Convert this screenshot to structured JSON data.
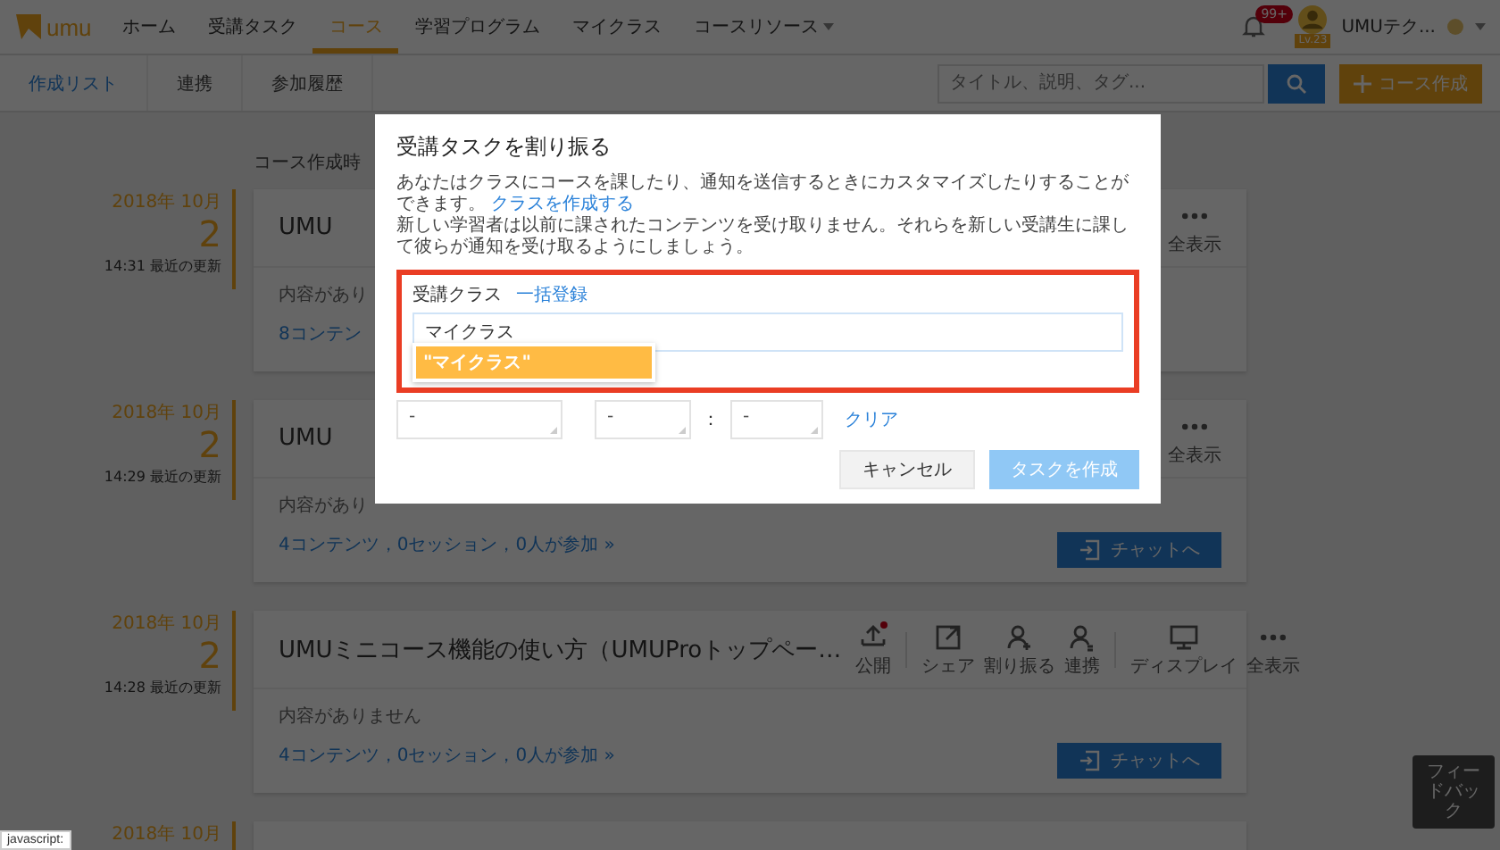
{
  "header": {
    "logo": "umu",
    "nav": [
      {
        "label": "ホーム",
        "selected": false,
        "dropdown": false
      },
      {
        "label": "受講タスク",
        "selected": false,
        "dropdown": false
      },
      {
        "label": "コース",
        "selected": true,
        "dropdown": false
      },
      {
        "label": "学習プログラム",
        "selected": false,
        "dropdown": false
      },
      {
        "label": "マイクラス",
        "selected": false,
        "dropdown": false
      },
      {
        "label": "コースリソース",
        "selected": false,
        "dropdown": true
      }
    ],
    "notification_badge": "99+",
    "user": {
      "level": "Lv.23",
      "name": "UMUテク..."
    }
  },
  "subnav": {
    "tabs": [
      {
        "label": "作成リスト",
        "selected": true
      },
      {
        "label": "連携",
        "selected": false
      },
      {
        "label": "参加履歴",
        "selected": false
      }
    ],
    "search": {
      "placeholder": "タイトル、説明、タグ..."
    },
    "create_button": "コース作成"
  },
  "list": {
    "heading": "コース作成時",
    "courses": [
      {
        "month": "2018年 10月",
        "day": "2",
        "updated": "14:31 最近の更新",
        "title": "UMU",
        "summary": "内容があり",
        "stats": "8コンテン",
        "actions": [
          {
            "label": "全表示",
            "kind": "more",
            "alert": false
          }
        ]
      },
      {
        "month": "2018年 10月",
        "day": "2",
        "updated": "14:29 最近の更新",
        "title": "UMU",
        "summary": "内容があり",
        "stats": "4コンテンツ，0セッション，0人が参加 »",
        "chat_button": "チャットへ",
        "actions": [
          {
            "label": "全表示",
            "kind": "more",
            "alert": false
          }
        ]
      },
      {
        "month": "2018年 10月",
        "day": "2",
        "updated": "14:28 最近の更新",
        "title": "UMUミニコース機能の使い方（UMUProトップペー…",
        "summary": "内容がありません",
        "stats": "4コンテンツ，0セッション，0人が参加 »",
        "chat_button": "チャットへ",
        "actions": [
          {
            "label": "公開",
            "kind": "publish",
            "alert": true
          },
          {
            "label": "シェア",
            "kind": "share",
            "alert": false
          },
          {
            "label": "割り振る",
            "kind": "assign",
            "alert": false
          },
          {
            "label": "連携",
            "kind": "link",
            "alert": false
          },
          {
            "label": "ディスプレイ",
            "kind": "display",
            "alert": false
          },
          {
            "label": "全表示",
            "kind": "more",
            "alert": false
          }
        ]
      },
      {
        "month": "2018年 10月"
      }
    ]
  },
  "feedback_button": "フィードバック",
  "modal": {
    "title": "受講タスクを割り振る",
    "description": "あなたはクラスにコースを課したり、通知を送信するときにカスタマイズしたりすることができます。",
    "description_link": "クラスを作成する",
    "description_2": "新しい学習者は以前に課されたコンテンツを受け取りません。それらを新しい受講生に課して彼らが通知を受け取るようにしましょう。",
    "class_field": {
      "label": "受講クラス",
      "link": "一括登録",
      "value": "マイクラス"
    },
    "suggestions": [
      {
        "label": "\"マイクラス\"",
        "selected": true
      }
    ],
    "schedule": {
      "date": "-",
      "hour": "-",
      "separator": "：",
      "minute": "-",
      "clear": "クリア"
    },
    "buttons": [
      {
        "label": "キャンセル",
        "kind": "secondary",
        "disabled": false
      },
      {
        "label": "タスクを作成",
        "kind": "primary",
        "disabled": true
      }
    ]
  },
  "status_text": "javascript:"
}
